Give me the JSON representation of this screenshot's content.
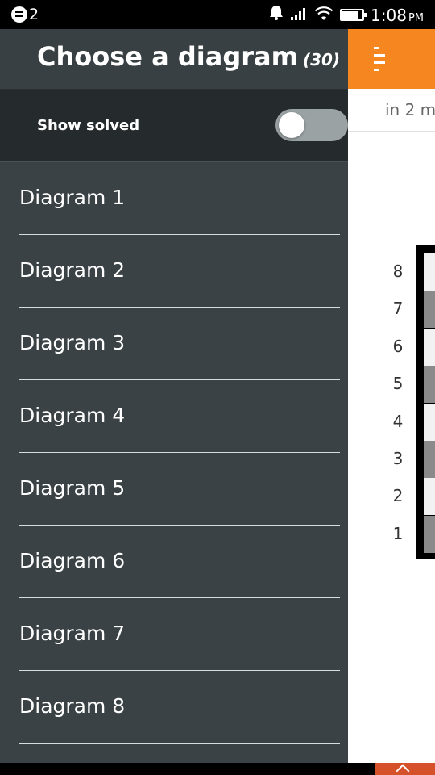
{
  "status_bar": {
    "notification_count": "2",
    "time": "1:08",
    "ampm": "PM",
    "icons": [
      "mail-icon",
      "bell-icon",
      "signal-icon",
      "wifi-icon",
      "battery-icon"
    ]
  },
  "drawer": {
    "title": "Choose a diagram",
    "count": "(30)",
    "show_solved_label": "Show solved",
    "show_solved": false,
    "items": [
      {
        "label": "Diagram 1"
      },
      {
        "label": "Diagram 2"
      },
      {
        "label": "Diagram 3"
      },
      {
        "label": "Diagram 4"
      },
      {
        "label": "Diagram 5"
      },
      {
        "label": "Diagram 6"
      },
      {
        "label": "Diagram 7"
      },
      {
        "label": "Diagram 8"
      }
    ]
  },
  "app": {
    "header_color": "#f6861f",
    "move_hint": "in 2 m",
    "ranks": [
      "8",
      "7",
      "6",
      "5",
      "4",
      "3",
      "2",
      "1"
    ]
  },
  "colors": {
    "drawer_bg": "#3a4245",
    "accent_orange": "#f6861f",
    "up_tab": "#d4512a"
  }
}
